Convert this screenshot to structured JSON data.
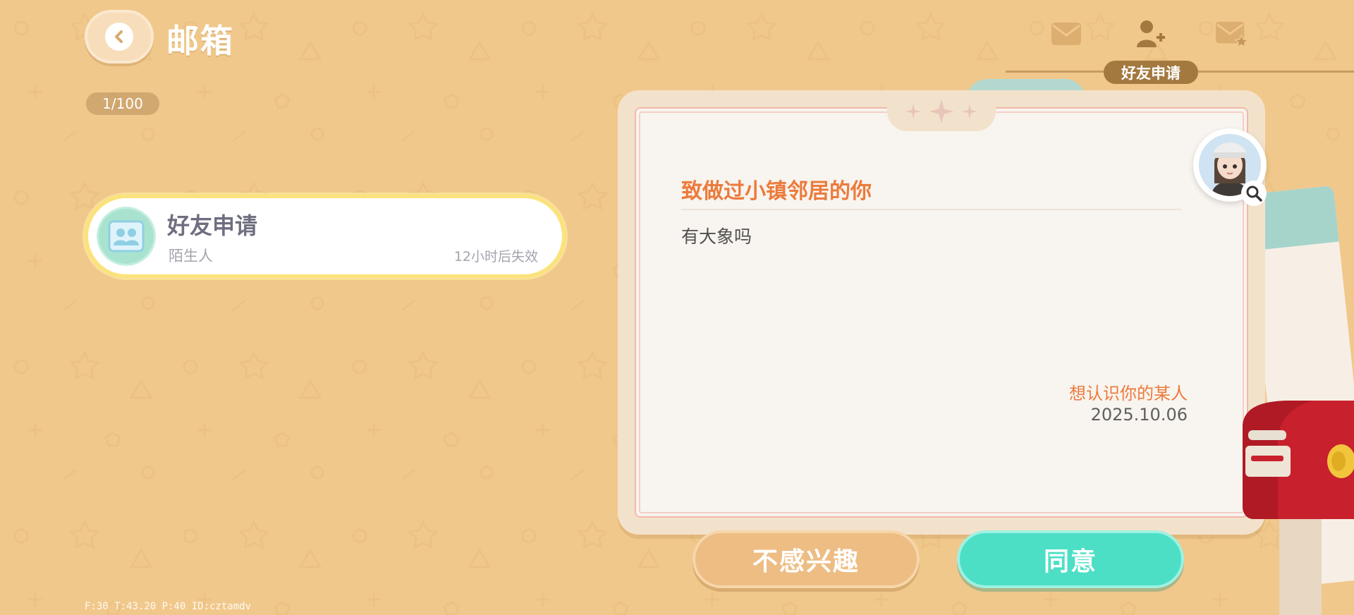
{
  "header": {
    "title": "邮箱",
    "mail_count": "1/100"
  },
  "tabs": {
    "items": [
      {
        "icon": "envelope-icon"
      },
      {
        "icon": "add-friend-icon"
      },
      {
        "icon": "envelope-star-icon"
      }
    ],
    "active_label": "好友申请"
  },
  "mail_list": [
    {
      "title": "好友申请",
      "subtitle": "陌生人",
      "expires": "12小时后失效"
    }
  ],
  "letter": {
    "title": "致做过小镇邻居的你",
    "body": "有大象吗",
    "signature": "想认识你的某人",
    "date": "2025.10.06"
  },
  "actions": {
    "decline_label": "不感兴趣",
    "agree_label": "同意"
  },
  "debug": "F:30   T:43.20   P:40   ID:cztamdv",
  "colors": {
    "background": "#f1c88b",
    "accent_orange": "#ec7b3c",
    "agree_teal": "#4cdfc6",
    "highlight_yellow": "#fbe27a"
  }
}
